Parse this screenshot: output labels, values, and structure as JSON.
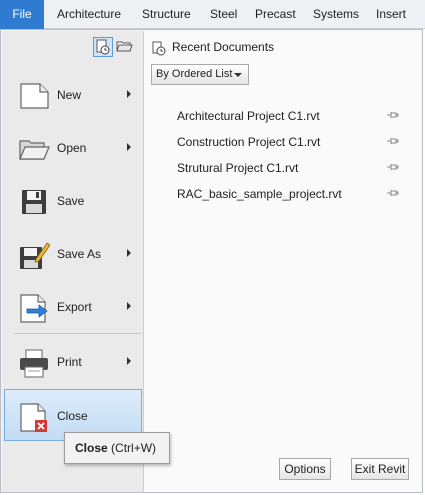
{
  "ribbon": {
    "tabs": [
      "File",
      "Architecture",
      "Structure",
      "Steel",
      "Precast",
      "Systems",
      "Insert"
    ]
  },
  "app_menu": {
    "commands": [
      {
        "label": "New",
        "icon": "new-file-icon",
        "has_submenu": true
      },
      {
        "label": "Open",
        "icon": "open-folder-icon",
        "has_submenu": true
      },
      {
        "label": "Save",
        "icon": "save-disk-icon",
        "has_submenu": false
      },
      {
        "label": "Save As",
        "icon": "save-as-icon",
        "has_submenu": true
      },
      {
        "label": "Export",
        "icon": "export-icon",
        "has_submenu": true
      },
      {
        "label": "Print",
        "icon": "printer-icon",
        "has_submenu": true
      },
      {
        "label": "Close",
        "icon": "close-document-icon",
        "has_submenu": false,
        "highlighted": true
      }
    ],
    "recent": {
      "title": "Recent Documents",
      "sort_label": "By Ordered List",
      "documents": [
        "Architectural Project C1.rvt",
        "Construction Project C1.rvt",
        "Strutural Project C1.rvt",
        "RAC_basic_sample_project.rvt"
      ]
    },
    "options_label": "Options",
    "exit_label": "Exit Revit"
  },
  "tooltip": {
    "name": "Close",
    "shortcut": "(Ctrl+W)"
  },
  "colors": {
    "file_tab": "#2e7bd0",
    "highlight": "#c3dcf4",
    "highlight_border": "#7aaee0"
  }
}
